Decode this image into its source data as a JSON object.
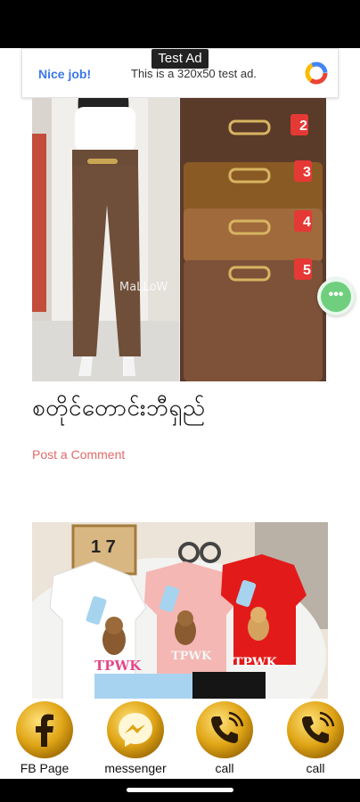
{
  "ad": {
    "tag": "Test Ad",
    "nice": "Nice job!",
    "text": "This is a 320x50 test ad."
  },
  "post": {
    "title": "စတိုင်တောင်းဘီရှည်",
    "comment_link": "Post a Comment"
  },
  "product1": {
    "watermark": "MaLLoW",
    "badges": [
      "2",
      "3",
      "4",
      "5"
    ]
  },
  "product2": {
    "calendar": "1 7",
    "shirt_text": "TPWK"
  },
  "floating": {
    "icon": "•••"
  },
  "bottom_bar": [
    {
      "label": "FB Page",
      "icon": "facebook-icon"
    },
    {
      "label": "messenger",
      "icon": "messenger-icon"
    },
    {
      "label": "call",
      "icon": "phone-icon"
    },
    {
      "label": "call",
      "icon": "phone-icon"
    }
  ],
  "colors": {
    "gold": "#e0a516",
    "ad_blue": "#3b78e7",
    "comment_red": "#e26a6a",
    "float_green": "#6fcf7e"
  }
}
